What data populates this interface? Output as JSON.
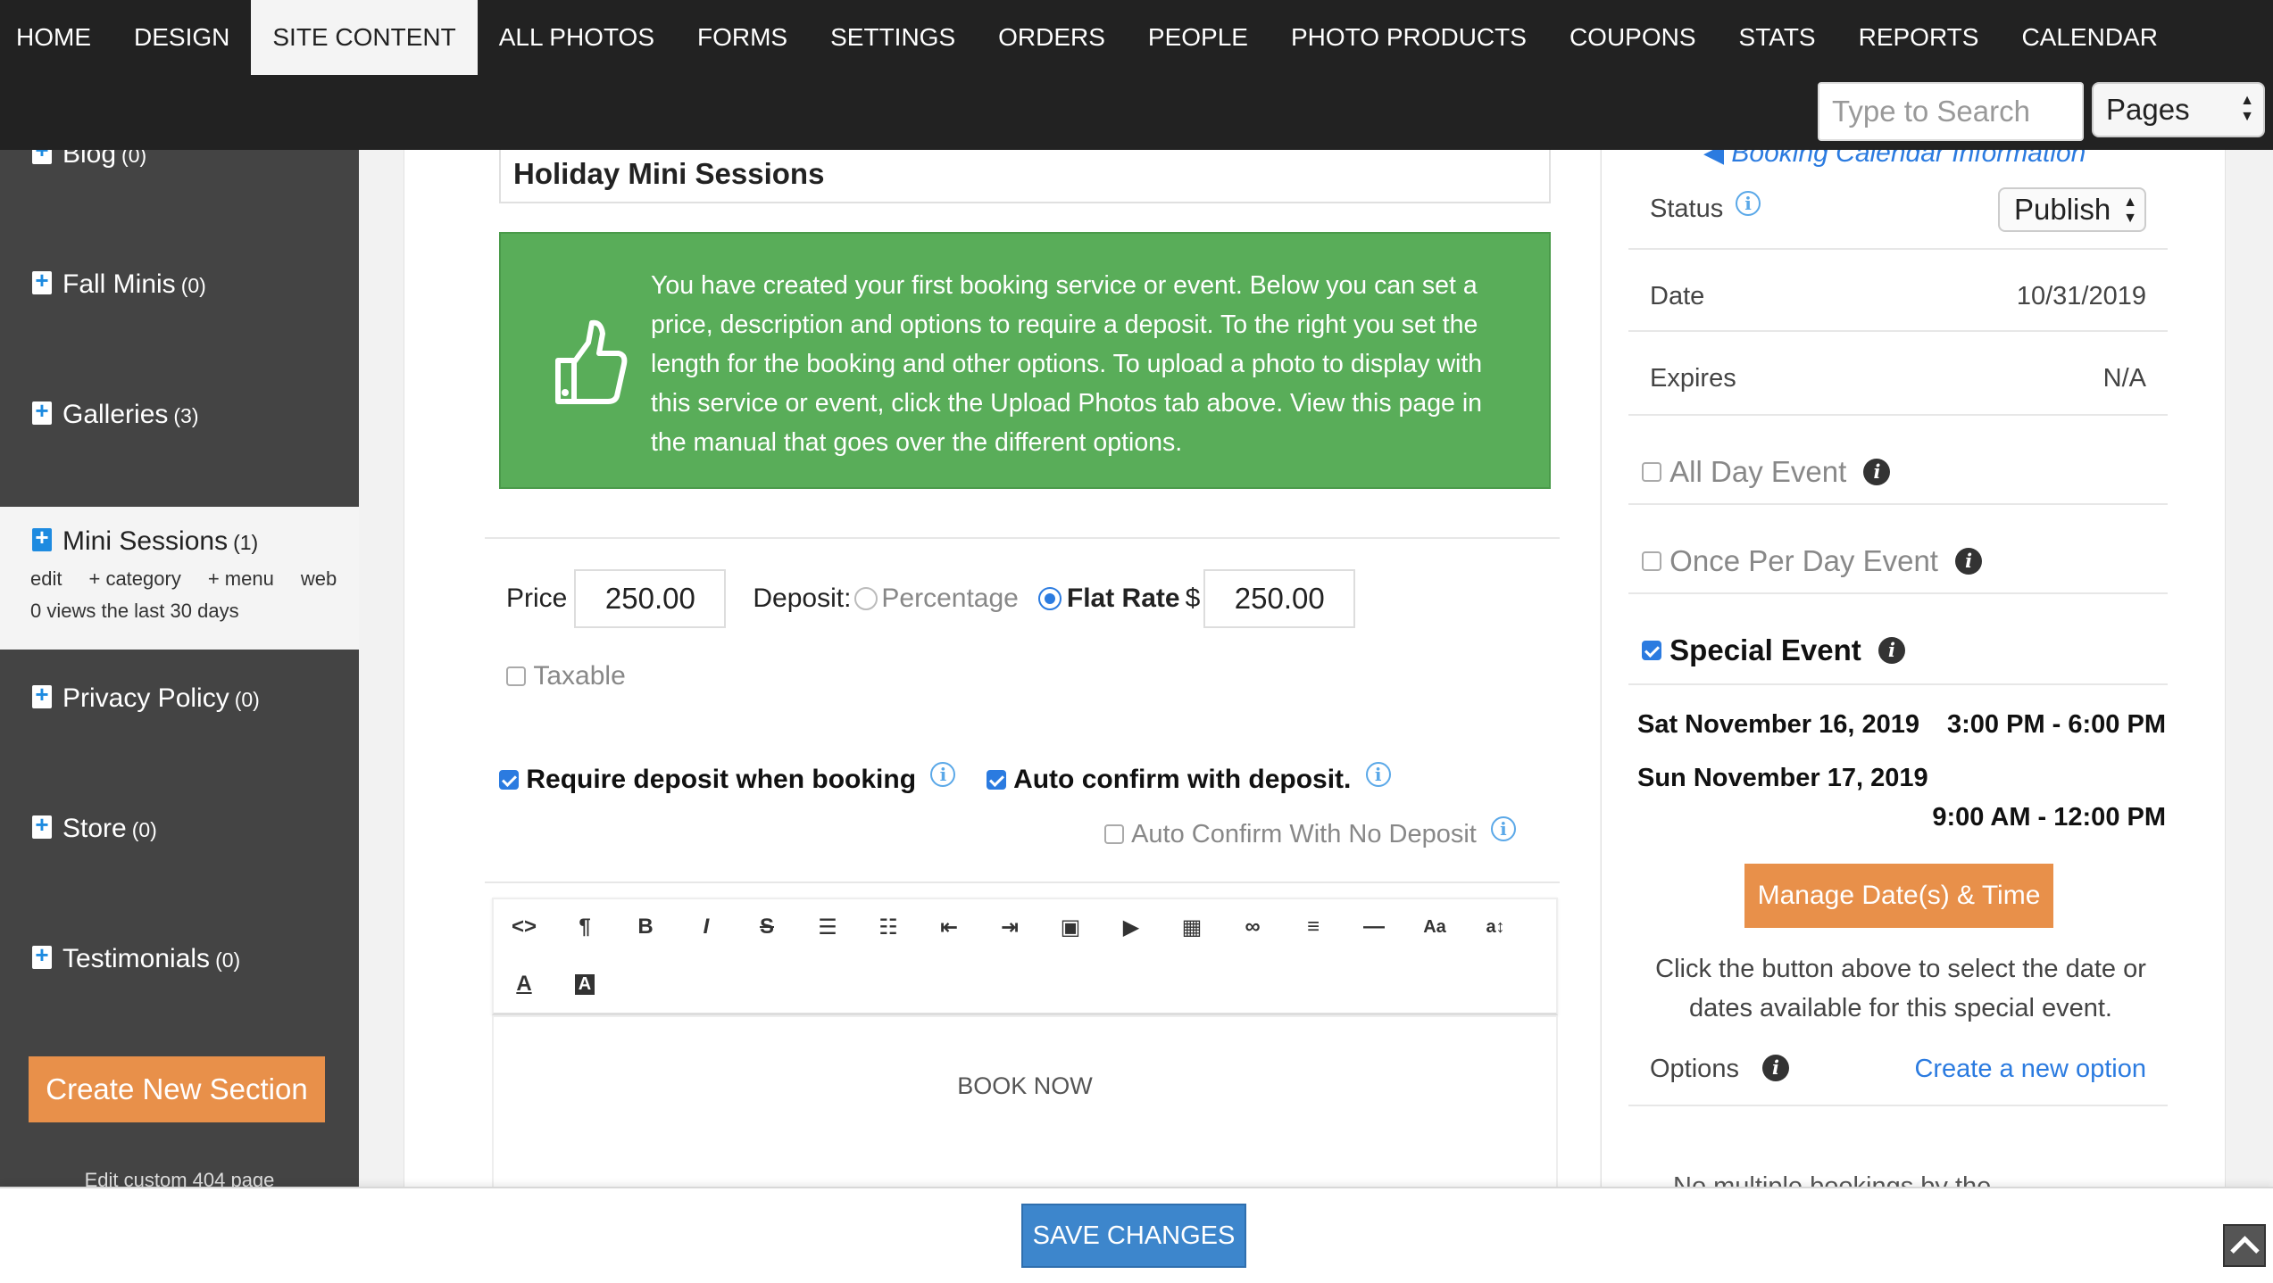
{
  "nav": {
    "items": [
      "HOME",
      "DESIGN",
      "SITE CONTENT",
      "ALL PHOTOS",
      "FORMS",
      "SETTINGS",
      "ORDERS",
      "PEOPLE",
      "PHOTO PRODUCTS",
      "COUPONS",
      "STATS",
      "REPORTS",
      "CALENDAR"
    ],
    "active": "SITE CONTENT"
  },
  "search": {
    "placeholder": "Type to Search"
  },
  "pages_select": {
    "value": "Pages"
  },
  "sidebar": {
    "items": [
      {
        "label": "Blog",
        "count": "(0)"
      },
      {
        "label": "Fall Minis",
        "count": "(0)"
      },
      {
        "label": "Galleries",
        "count": "(3)"
      },
      {
        "label": "Mini Sessions",
        "count": "(1)",
        "links": [
          "edit",
          "+ category",
          "+ menu",
          "web"
        ],
        "views": "0 views the last 30 days"
      },
      {
        "label": "Privacy Policy",
        "count": "(0)"
      },
      {
        "label": "Store",
        "count": "(0)"
      },
      {
        "label": "Testimonials",
        "count": "(0)"
      }
    ],
    "create_button": "Create New Section",
    "footer_text": "Edit custom 404 page"
  },
  "editor": {
    "title": "Holiday Mini Sessions",
    "notice": "You have created your first booking service or event. Below you can set a price, description and options to require a deposit. To the right you set the length for the booking and other options. To upload a photo to display with this service or event, click the Upload Photos tab above. View this page in the manual that goes over the different options.",
    "price_label": "Price",
    "price_value": "250.00",
    "deposit_label": "Deposit:",
    "percentage_label": "Percentage",
    "flat_rate_label": "Flat Rate",
    "currency": "$",
    "deposit_value": "250.00",
    "taxable_label": "Taxable",
    "require_deposit_label": "Require deposit when booking",
    "auto_confirm_label": "Auto confirm with deposit.",
    "auto_confirm_no_deposit_label": "Auto Confirm With No Deposit",
    "toolbar_icons": [
      "code-view-icon",
      "paragraph-icon",
      "bold-icon",
      "italic-icon",
      "strikethrough-icon",
      "bullet-list-icon",
      "numbered-list-icon",
      "outdent-icon",
      "indent-icon",
      "image-icon",
      "video-icon",
      "table-icon",
      "link-icon",
      "align-icon",
      "horizontal-rule-icon",
      "font-size-icon",
      "line-height-icon",
      "text-color-icon",
      "background-color-icon"
    ],
    "body_text": "BOOK NOW"
  },
  "right": {
    "calendar_link": "Booking Calendar Information",
    "status_label": "Status",
    "status_value": "Publish",
    "date_label": "Date",
    "date_value": "10/31/2019",
    "expires_label": "Expires",
    "expires_value": "N/A",
    "all_day_label": "All Day Event",
    "once_per_day_label": "Once Per Day Event",
    "special_event_label": "Special Event",
    "dates": [
      {
        "day": "Sat November 16, 2019",
        "time": "3:00 PM - 6:00 PM"
      },
      {
        "day": "Sun November 17, 2019",
        "time": "9:00 AM - 12:00 PM"
      }
    ],
    "manage_button": "Manage Date(s) & Time",
    "manage_help": "Click the button above to select the date or dates available for this special event.",
    "options_label": "Options",
    "create_option_link": "Create a new option",
    "footer_text": "No multiple bookings by the..."
  },
  "bottom": {
    "save_button": "SAVE CHANGES"
  },
  "colors": {
    "accent_orange": "#e8904a",
    "notice_green": "#59ad59",
    "link_blue": "#2b7be0",
    "save_blue": "#3d86cc",
    "topbar": "#222222",
    "sidebar": "#444444"
  }
}
